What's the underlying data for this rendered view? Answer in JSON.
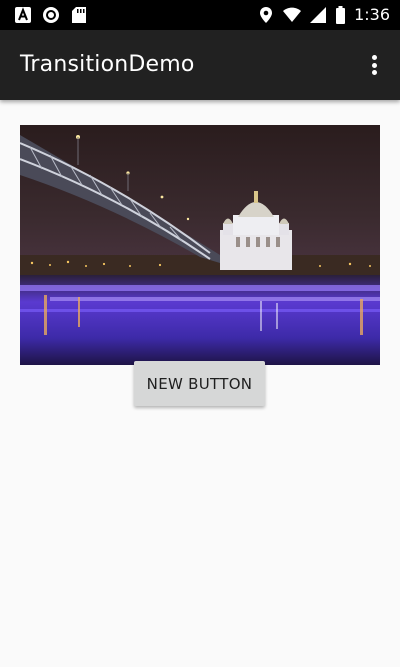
{
  "status_bar": {
    "time": "1:36",
    "left_icons": [
      "text-a-icon",
      "circle-record-icon",
      "sd-card-icon"
    ],
    "right_icons": [
      "location-icon",
      "wifi-icon",
      "signal-icon",
      "battery-icon"
    ]
  },
  "app_bar": {
    "title": "TransitionDemo",
    "menu_icon": "overflow-menu-icon",
    "background": "#212121"
  },
  "main": {
    "image": "night-bridge-cathedral-photo",
    "button_label": "NEW BUTTON"
  },
  "colors": {
    "status_bar": "#000000",
    "app_bar": "#212121",
    "background": "#fafafa",
    "button": "#d6d7d7"
  }
}
